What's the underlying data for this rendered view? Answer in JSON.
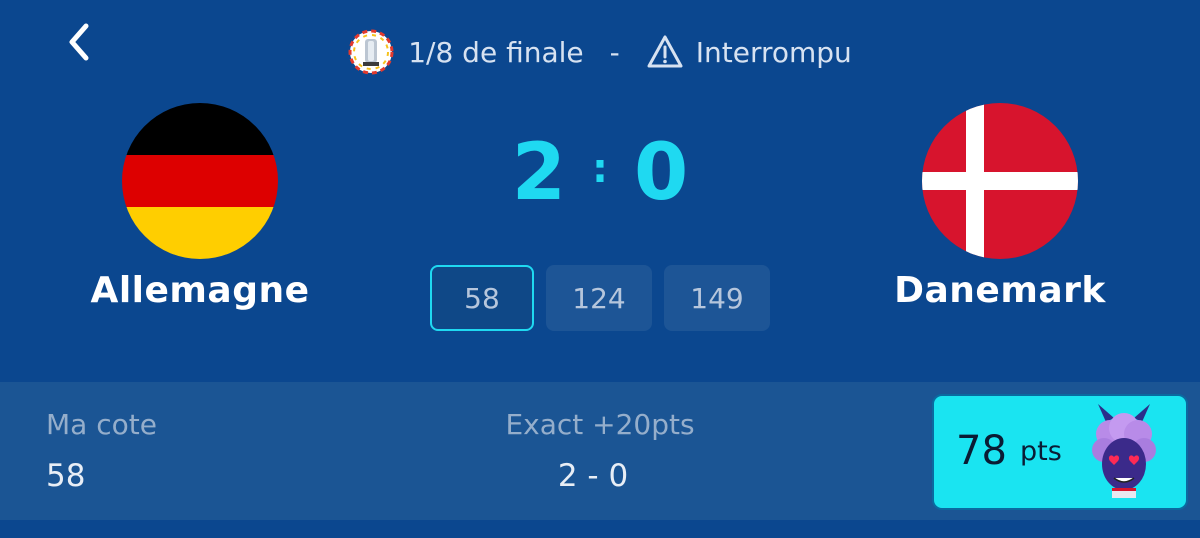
{
  "header": {
    "stage": "1/8 de finale",
    "separator": "-",
    "status": "Interrompu"
  },
  "match": {
    "home_team": "Allemagne",
    "away_team": "Danemark",
    "home_score": "2",
    "away_score": "0",
    "score_separator": ":"
  },
  "odds": [
    "58",
    "124",
    "149"
  ],
  "footer": {
    "my_odds_label": "Ma cote",
    "my_odds_value": "58",
    "exact_label": "Exact +20pts",
    "exact_value": "2 - 0",
    "points_value": "78",
    "points_unit": "pts"
  },
  "icons": {
    "back": "chevron-left-icon",
    "trophy": "trophy-icon",
    "warning": "warning-icon"
  },
  "colors": {
    "background": "#0b478f",
    "accent": "#1fd9f1",
    "footer": "#1b5594",
    "points_card": "#1ae4f1"
  }
}
